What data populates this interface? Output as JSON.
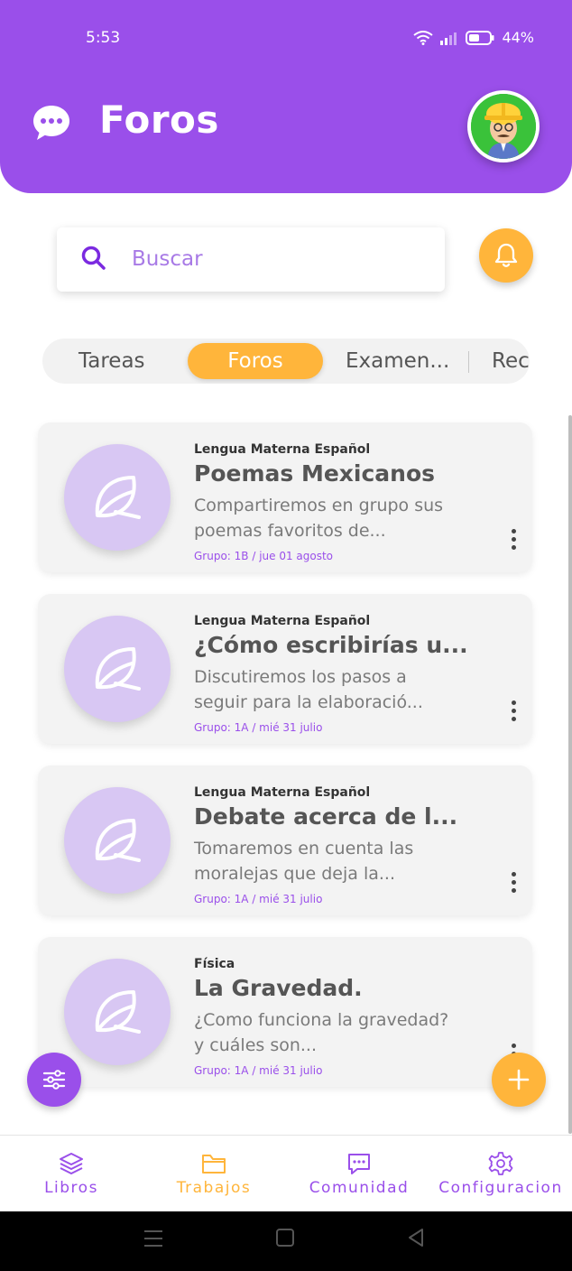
{
  "status_bar": {
    "time": "5:53",
    "battery": "44%"
  },
  "header": {
    "title": "Foros",
    "icon": "chat-bubble-icon",
    "avatar": "worker-avatar"
  },
  "search": {
    "placeholder": "Buscar",
    "value": ""
  },
  "tabs": [
    {
      "label": "Tareas",
      "active": false
    },
    {
      "label": "Foros",
      "active": true
    },
    {
      "label": "Examen...",
      "active": false
    },
    {
      "label": "Rec",
      "active": false
    }
  ],
  "forums": [
    {
      "subject": "Lengua Materna Español",
      "title": "Poemas Mexicanos",
      "description": "Compartiremos en grupo sus poemas favoritos de...",
      "meta": "Grupo: 1B / jue 01 agosto",
      "icon": "leaf-icon"
    },
    {
      "subject": "Lengua Materna Español",
      "title": "¿Cómo escribirías u...",
      "description": "Discutiremos los pasos a seguir para la elaboració...",
      "meta": "Grupo: 1A / mié 31 julio",
      "icon": "leaf-icon"
    },
    {
      "subject": "Lengua Materna Español",
      "title": "Debate acerca de l...",
      "description": "Tomaremos en cuenta las moralejas que deja la...",
      "meta": "Grupo: 1A / mié 31 julio",
      "icon": "leaf-icon"
    },
    {
      "subject": "Física",
      "title": "La Gravedad.",
      "description": "¿Como funciona la gravedad? y cuáles son...",
      "meta": "Grupo: 1A / mié 31 julio",
      "icon": "leaf-icon"
    }
  ],
  "bottom_nav": [
    {
      "label": "Libros",
      "icon": "layers-icon",
      "color": "#9a4fea"
    },
    {
      "label": "Trabajos",
      "icon": "folder-icon",
      "color": "#ffb53b"
    },
    {
      "label": "Comunidad",
      "icon": "chat-icon",
      "color": "#9a4fea"
    },
    {
      "label": "Configuracion",
      "icon": "gear-icon",
      "color": "#9a4fea"
    }
  ],
  "colors": {
    "primary": "#9a4fea",
    "accent": "#ffb53b",
    "card_bg": "#f3f3f3",
    "thumb_bg": "#d8c7f3"
  }
}
